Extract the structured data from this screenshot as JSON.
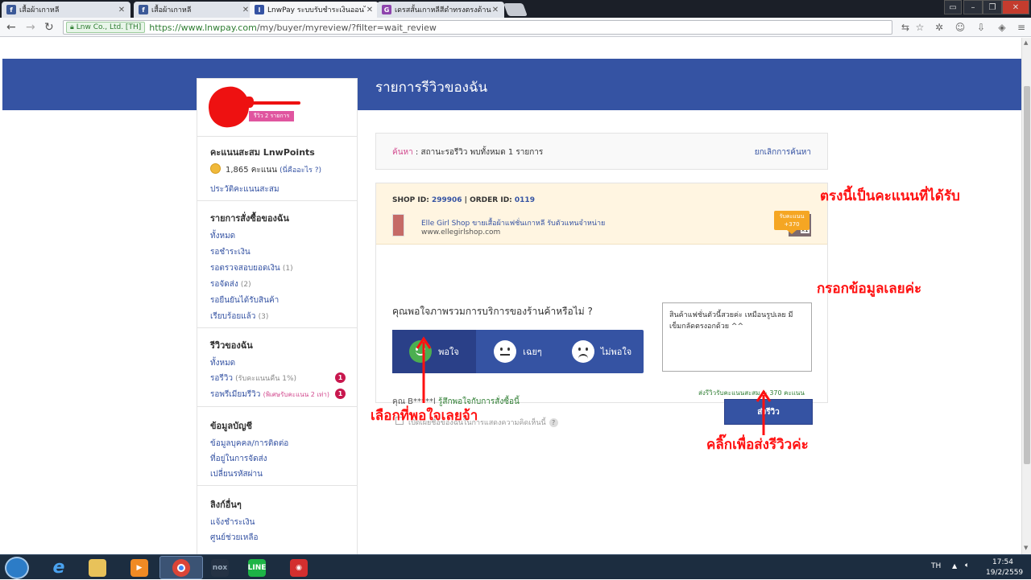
{
  "browser": {
    "tabs": [
      {
        "title": "เสื้อผ้าเกาหลี",
        "favicon": "facebook-icon"
      },
      {
        "title": "เสื้อผ้าเกาหลี",
        "favicon": "facebook-icon"
      },
      {
        "title": "LnwPay ระบบรับชำระเงินออนไ...",
        "favicon": "lnw-icon"
      },
      {
        "title": "เดรสสั้นเกาหลีสีดำทรงตรงด้าน...",
        "favicon": "g-icon"
      }
    ],
    "cert_label": "Lnw Co., Ltd. [TH]",
    "url_scheme": "https://www.lnwpay.com",
    "url_path": "/my/buyer/myreview/?filter=wait_review"
  },
  "banner": {
    "title": "รายการรีวิวของฉัน"
  },
  "profile": {
    "review_badge": "รีวิว 2 รายการ"
  },
  "sidebar": {
    "points_head": "คะแนนสะสม LnwPoints",
    "points_value": "1,865 คะแนน",
    "points_hint": "(นี่คืออะไร ?)",
    "points_history": "ประวัติคะแนนสะสม",
    "orders_head": "รายการสั่งซื้อของฉัน",
    "orders": [
      {
        "label": "ทั้งหมด",
        "count": ""
      },
      {
        "label": "รอชำระเงิน",
        "count": ""
      },
      {
        "label": "รอตรวจสอบยอดเงิน",
        "count": "(1)"
      },
      {
        "label": "รอจัดส่ง",
        "count": "(2)"
      },
      {
        "label": "รอยืนยันได้รับสินค้า",
        "count": ""
      },
      {
        "label": "เรียบร้อยแล้ว",
        "count": "(3)"
      }
    ],
    "reviews_head": "รีวิวของฉัน",
    "reviews": [
      {
        "label": "ทั้งหมด",
        "note": "",
        "badge": ""
      },
      {
        "label": "รอรีวิว",
        "note": "(รับคะแนนคืน 1%)",
        "badge": "1"
      },
      {
        "label": "รอพรีเมียมรีวิว",
        "note": "(พิเศษรับคะแนน 2 เท่า)",
        "badge": "1"
      }
    ],
    "account_head": "ข้อมูลบัญชี",
    "account": [
      "ข้อมูลบุคคล/การติดต่อ",
      "ที่อยู่ในการจัดส่ง",
      "เปลี่ยนรหัสผ่าน"
    ],
    "links_head": "ลิงก์อื่นๆ",
    "links": [
      "แจ้งชำระเงิน",
      "ศูนย์ช่วยเหลือ"
    ]
  },
  "search": {
    "key": "ค้นหา",
    "summary": " : สถานะรอรีวิว พบทั้งหมด 1 รายการ",
    "cancel": "ยกเลิกการค้นหา"
  },
  "order": {
    "shop_id_label": "SHOP ID: ",
    "shop_id": "299906",
    "order_id_label": " | ORDER ID: ",
    "order_id": "0119",
    "shop_name": "Elle Girl Shop ขายเสื้อผ้าแฟชั่นเกาหลี รับตัวแทนจำหน่าย",
    "shop_url": "www.ellegirlshop.com",
    "item_qty": "x1",
    "reward_line1": "รับคะแนน",
    "reward_line2": "+370",
    "question": "คุณพอใจภาพรวมการบริการของร้านค้าหรือไม่ ?",
    "ratings": [
      {
        "label": "พอใจ",
        "selected": true
      },
      {
        "label": "เฉยๆ",
        "selected": false
      },
      {
        "label": "ไม่พอใจ",
        "selected": false
      }
    ],
    "review_text": "สินค้าแฟชั่นตัวนี้สวยค่ะ เหมือนรูปเลย มีเข็มกลัดตรงอกด้วย ^^",
    "points_note": "ส่งรีวิวรับคะแนนสะสม + 370 คะแนน",
    "user_prefix": "คุณ B*****l ",
    "user_ask": "รู้สึกพอใจกับการสั่งซื้อนี้",
    "anon_label": "เปิดเผยชื่อของฉันในการแสดงความคิดเห็นนี้",
    "help": "?",
    "submit": "ส่งรีวิว"
  },
  "annotations": {
    "points": "ตรงนี้เป็นคะแนนที่ได้รับ",
    "fill": "กรอกข้อมูลเลยค่ะ",
    "choose": "เลือกที่พอใจเลยจ้า",
    "click": "คลิ๊กเพื่อส่งรีวิวค่ะ"
  },
  "taskbar": {
    "lang": "TH",
    "time": "17:54",
    "date": "19/2/2559"
  }
}
